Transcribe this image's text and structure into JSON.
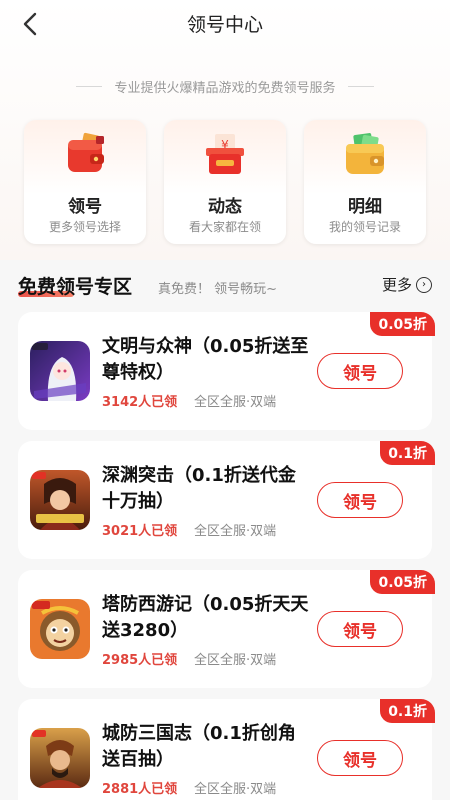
{
  "header": {
    "title": "领号中心"
  },
  "tagline": "专业提供火爆精品游戏的免费领号服务",
  "cards": [
    {
      "label": "领号",
      "sub": "更多领号选择",
      "icon": "red-wallet-icon"
    },
    {
      "label": "动态",
      "sub": "看大家都在领",
      "icon": "gift-box-icon"
    },
    {
      "label": "明细",
      "sub": "我的领号记录",
      "icon": "yellow-wallet-icon"
    }
  ],
  "section": {
    "title": "免费领号专区",
    "subtitle": "真免费！ 领号畅玩~",
    "more": "更多"
  },
  "games": [
    {
      "name": "文明与众神（0.05折送至尊特权）",
      "badge": "0.05折",
      "count": "3142人已领",
      "meta": "全区全服·双端",
      "button": "领号",
      "icon": "anime-girl-game-icon"
    },
    {
      "name": "深渊突击（0.1折送代金十万抽）",
      "badge": "0.1折",
      "count": "3021人已领",
      "meta": "全区全服·双端",
      "button": "领号",
      "icon": "warrior-game-icon"
    },
    {
      "name": "塔防西游记（0.05折天天送3280）",
      "badge": "0.05折",
      "count": "2985人已领",
      "meta": "全区全服·双端",
      "button": "领号",
      "icon": "monkey-king-game-icon"
    },
    {
      "name": "城防三国志（0.1折创角送百抽）",
      "badge": "0.1折",
      "count": "2881人已领",
      "meta": "全区全服·双端",
      "button": "领号",
      "icon": "three-kingdoms-game-icon"
    }
  ],
  "colors": {
    "accent": "#e8302a",
    "count": "#e0463d"
  }
}
